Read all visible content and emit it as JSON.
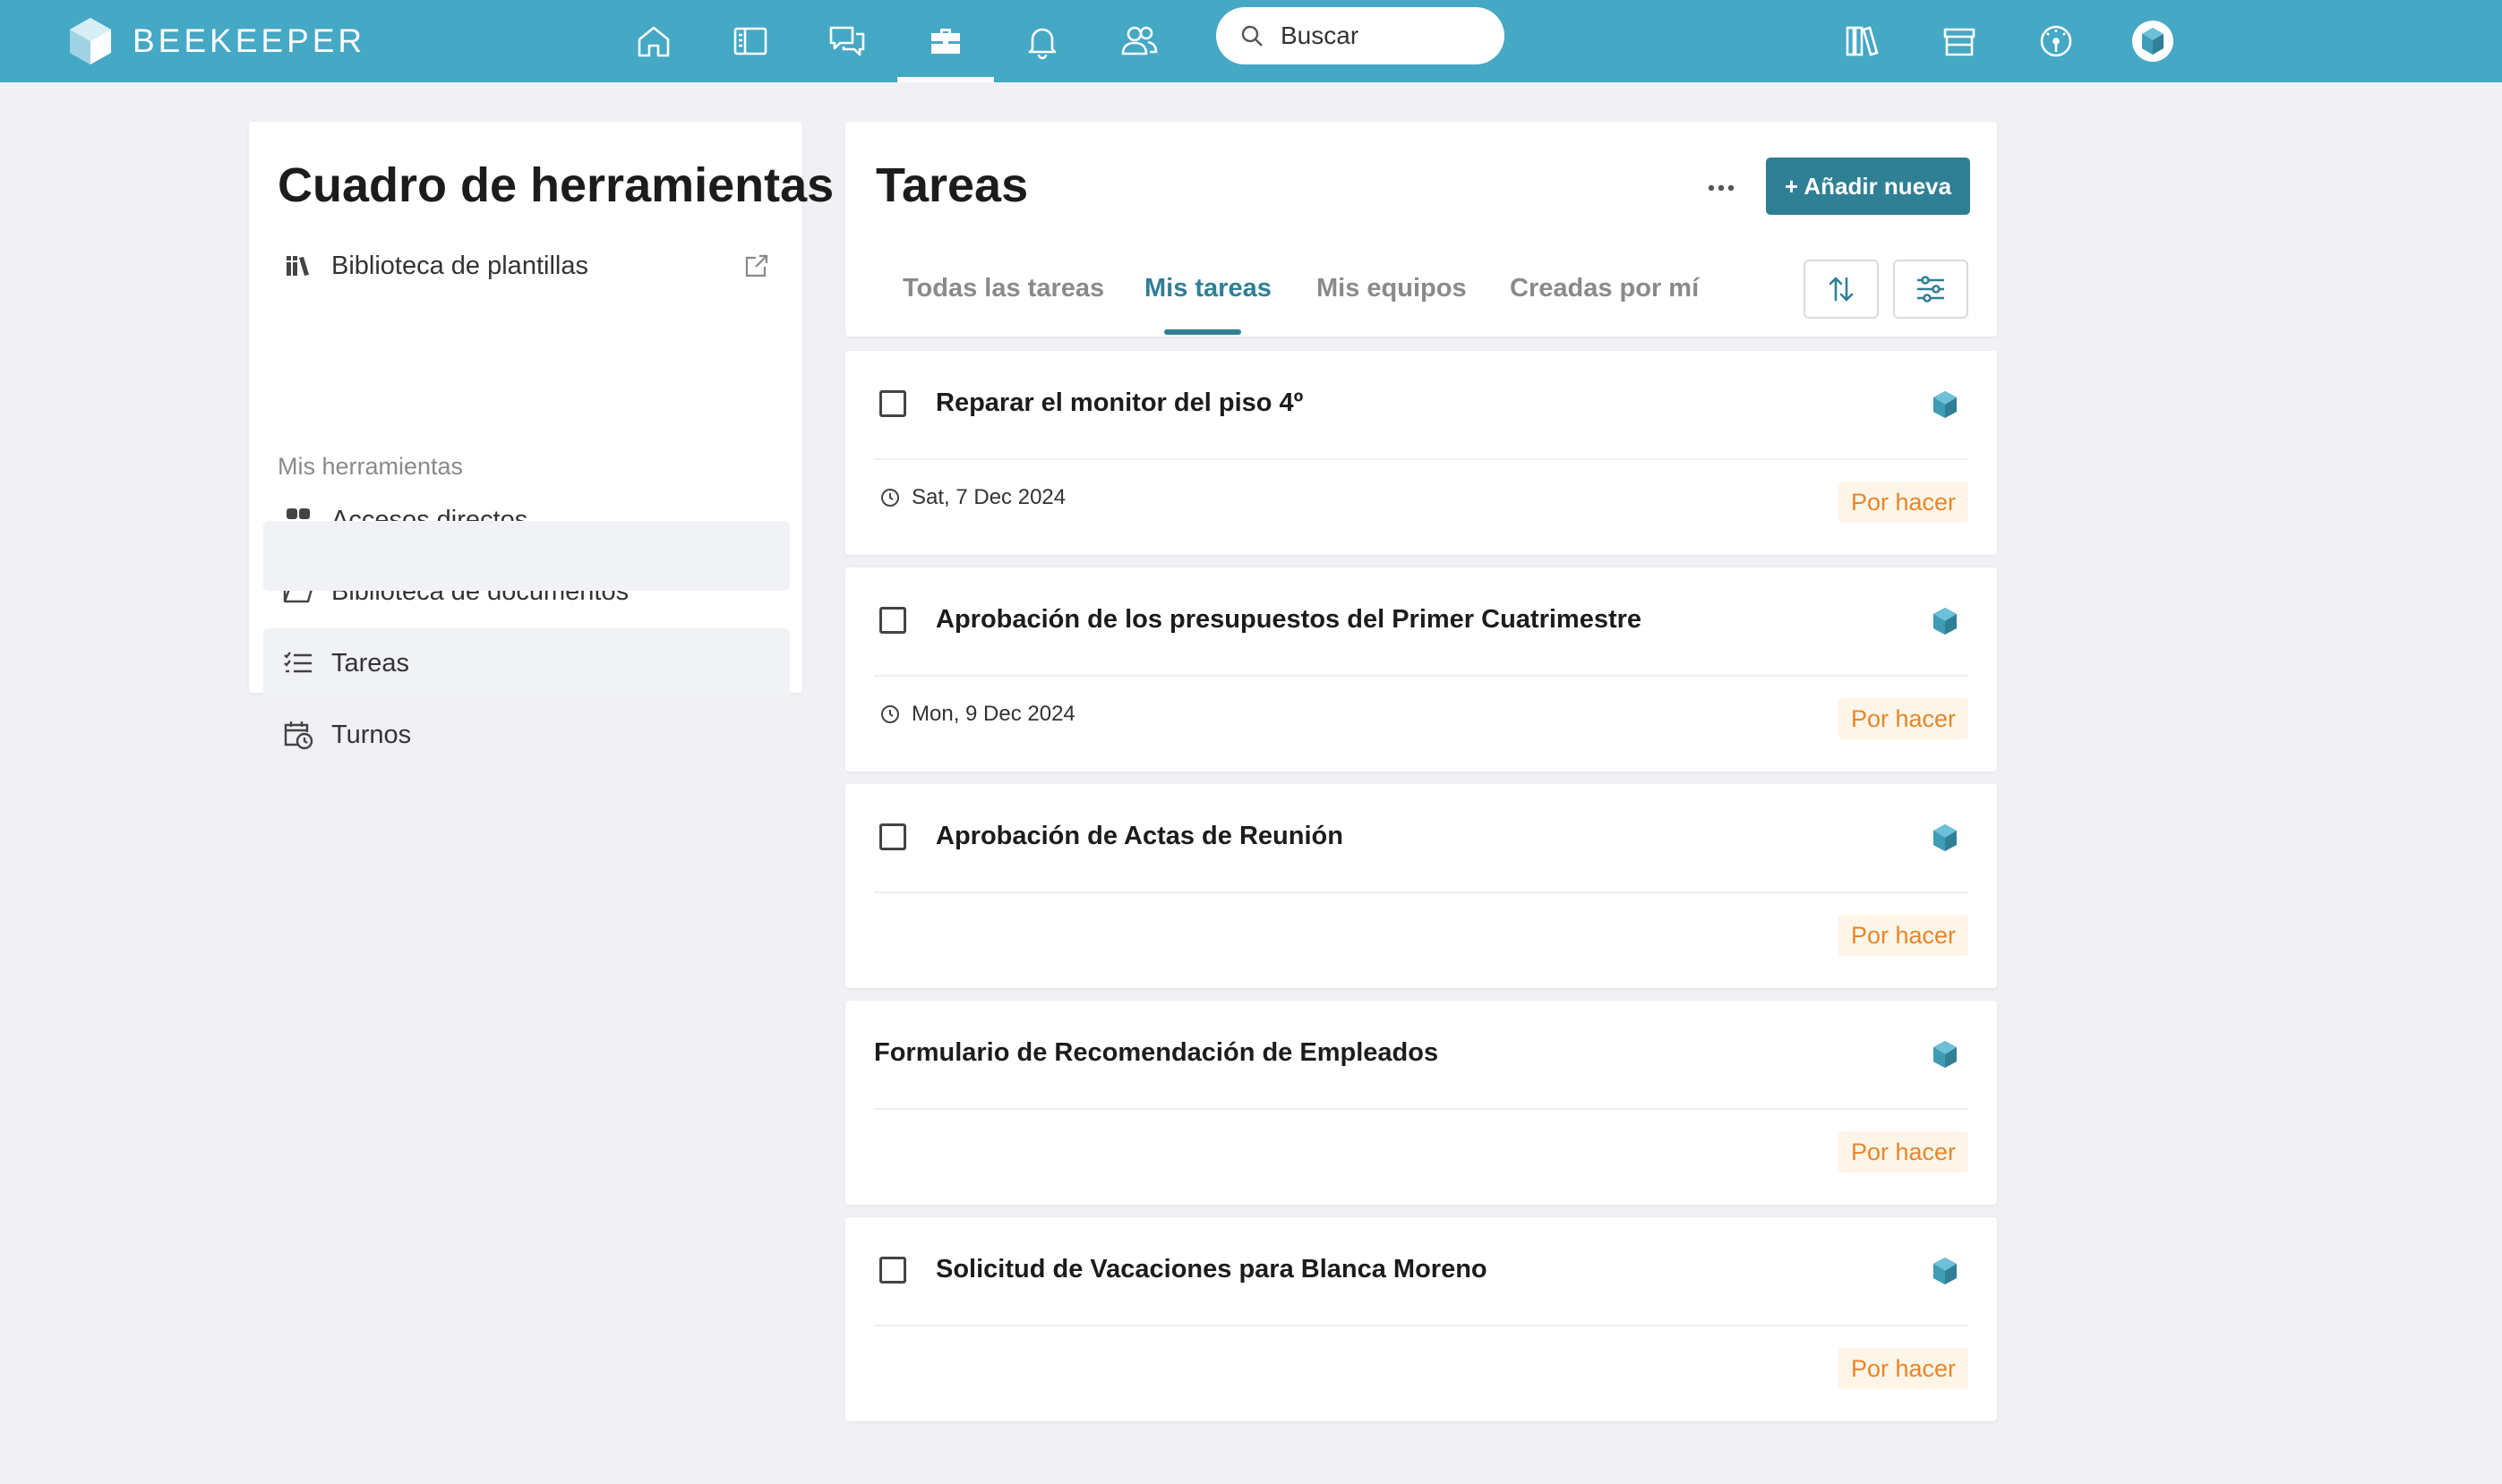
{
  "topbar": {
    "brand": "BEEKEEPER",
    "search_placeholder": "Buscar",
    "colors": {
      "bar": "#45a8c4",
      "accent": "#2f7f95"
    },
    "nav_icons": [
      "home-icon",
      "news-icon",
      "chat-icon",
      "toolbox-icon",
      "bell-icon",
      "people-icon"
    ],
    "right_icons": [
      "library-icon",
      "store-icon",
      "dashboard-icon",
      "profile-avatar"
    ]
  },
  "sidebar": {
    "title": "Cuadro de herramientas",
    "template_library": "Biblioteca de plantillas",
    "section_label": "Mis herramientas",
    "items": [
      {
        "label": "Accesos directos",
        "icon": "grid-icon"
      },
      {
        "label": "Biblioteca de documentos",
        "icon": "folder-icon"
      },
      {
        "label": "Tareas",
        "icon": "tasks-icon",
        "active": true
      },
      {
        "label": "Turnos",
        "icon": "calendar-clock-icon"
      }
    ]
  },
  "main": {
    "title": "Tareas",
    "add_button": "+ Añadir nueva",
    "tabs": [
      {
        "label": "Todas las tareas"
      },
      {
        "label": "Mis tareas",
        "active": true
      },
      {
        "label": "Mis equipos"
      },
      {
        "label": "Creadas por mí"
      }
    ],
    "tasks": [
      {
        "title": "Reparar el monitor del piso 4º",
        "date": "Sat, 7 Dec 2024",
        "status": "Por hacer",
        "checkbox": true
      },
      {
        "title": "Aprobación de los presupuestos del Primer Cuatrimestre",
        "date": "Mon, 9 Dec 2024",
        "status": "Por hacer",
        "checkbox": true
      },
      {
        "title": "Aprobación de Actas de Reunión",
        "date": "",
        "status": "Por hacer",
        "checkbox": true
      },
      {
        "title": "Formulario de Recomendación de Empleados",
        "date": "",
        "status": "Por hacer",
        "checkbox": false
      },
      {
        "title": "Solicitud de Vacaciones para Blanca Moreno",
        "date": "",
        "status": "Por hacer",
        "checkbox": true
      }
    ]
  }
}
